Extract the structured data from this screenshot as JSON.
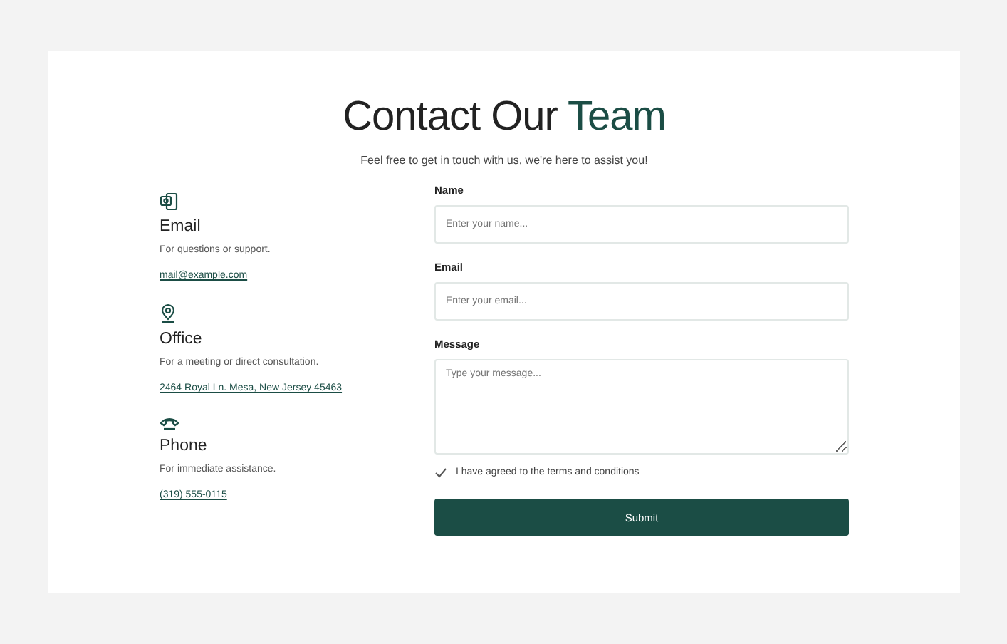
{
  "header": {
    "title_lead": "Contact Our",
    "title_accent": "Team",
    "subtitle": "Feel free to get in touch with us, we're here to assist you!"
  },
  "contacts": [
    {
      "kind": "email",
      "title": "Email",
      "description": "For questions or support.",
      "link": "mail@example.com"
    },
    {
      "kind": "office",
      "title": "Office",
      "description": "For a meeting or direct consultation.",
      "link": "2464 Royal Ln. Mesa, New Jersey 45463"
    },
    {
      "kind": "phone",
      "title": "Phone",
      "description": "For immediate assistance.",
      "link": "(319) 555-0115"
    }
  ],
  "form": {
    "fields": [
      {
        "kind": "input",
        "label": "Name",
        "placeholder": "Enter your name..."
      },
      {
        "kind": "input",
        "label": "Email",
        "placeholder": "Enter your email..."
      },
      {
        "kind": "textarea",
        "label": "Message",
        "placeholder": "Type your message..."
      }
    ],
    "agreement": {
      "label": "I have agreed to the terms and conditions",
      "checked": true
    },
    "submit": "Submit"
  }
}
